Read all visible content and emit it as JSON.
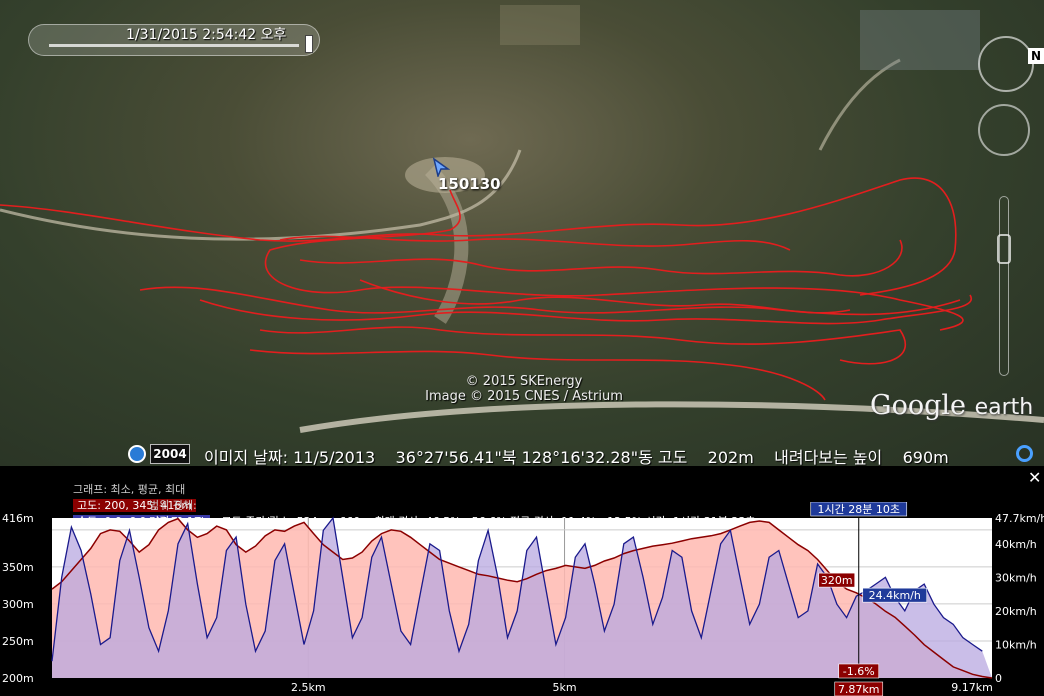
{
  "map": {
    "time_slider_label": "1/31/2015   2:54:42 오후",
    "placemark_label": "150130",
    "copyright_line1": "© 2015 SKEnergy",
    "copyright_line2": "Image © 2015 CNES / Astrium",
    "logo_google": "Google",
    "logo_earth": "earth",
    "north_label": "N"
  },
  "status": {
    "year": "2004",
    "info": "이미지 날짜: 11/5/2013    36°27'56.41\"북 128°16'32.28\"동 고도    202m    내려다보는 높이    690m"
  },
  "profile": {
    "graph_label": "그래프: 최소, 평균, 최대",
    "elevation_badge": "고도: 200, 345, 416m",
    "speed_badge": "속도: 0.0, 6.0, 47.7km/h",
    "range_label": "범위 전체:",
    "range_info": "거리: 9.17km 고도 증가/감소: 524m, -660m 최대 경사: 46.5%, -56.6% 평균 경사: 11.4%, -12.5% 시간: 1시간 31분 23초",
    "cursor_time": "1시간 28분 10초",
    "cursor_elev": "320m",
    "cursor_speed": "24.4km/h",
    "cursor_slope": "-1.6%",
    "cursor_dist": "7.87km",
    "x_ticks": [
      "2.5km",
      "5km",
      "9.17km"
    ],
    "y_left_ticks": [
      "416m",
      "350m",
      "300m",
      "250m",
      "200m"
    ],
    "y_right_ticks": [
      "47.7km/h",
      "40km/h",
      "30km/h",
      "20km/h",
      "10km/h",
      "0"
    ]
  },
  "chart_data": {
    "type": "area",
    "xlabel": "",
    "ylabel": "",
    "x_range_km": [
      0,
      9.17
    ],
    "elevation_range_m": [
      200,
      416
    ],
    "speed_range_kmh": [
      0,
      47.7
    ],
    "elevation_samples_m": [
      320,
      330,
      345,
      360,
      375,
      395,
      400,
      398,
      385,
      370,
      380,
      400,
      410,
      415,
      400,
      390,
      395,
      405,
      400,
      380,
      370,
      378,
      392,
      400,
      398,
      405,
      410,
      395,
      380,
      370,
      360,
      362,
      370,
      385,
      395,
      400,
      398,
      390,
      380,
      370,
      360,
      355,
      350,
      345,
      340,
      338,
      335,
      332,
      330,
      334,
      340,
      345,
      348,
      352,
      350,
      348,
      352,
      358,
      362,
      368,
      372,
      375,
      378,
      380,
      382,
      385,
      388,
      390,
      392,
      395,
      400,
      405,
      410,
      412,
      410,
      400,
      390,
      380,
      372,
      360,
      345,
      330,
      320,
      315,
      308,
      300,
      290,
      282,
      270,
      258,
      245,
      235,
      225,
      215,
      210,
      205,
      202,
      200
    ],
    "speed_samples_kmh": [
      5,
      30,
      45,
      38,
      25,
      10,
      12,
      35,
      44,
      30,
      15,
      8,
      20,
      40,
      46,
      28,
      12,
      18,
      38,
      42,
      22,
      8,
      14,
      35,
      40,
      25,
      10,
      20,
      44,
      47.7,
      30,
      12,
      18,
      36,
      42,
      28,
      14,
      10,
      25,
      40,
      38,
      20,
      8,
      16,
      35,
      44,
      30,
      12,
      20,
      38,
      42,
      26,
      10,
      18,
      36,
      40,
      28,
      14,
      22,
      40,
      42,
      30,
      16,
      24,
      38,
      36,
      20,
      12,
      26,
      40,
      44,
      30,
      16,
      22,
      36,
      38,
      28,
      18,
      20,
      34,
      30,
      22,
      18,
      24.4,
      26,
      28,
      30,
      24,
      20,
      26,
      28,
      22,
      18,
      16,
      12,
      10,
      8
    ]
  },
  "colors": {
    "track_red": "#e31e1e",
    "elevation_line": "#8b0000",
    "speed_line": "#1a1a8c",
    "elevation_fill": "#ffb8b0",
    "speed_fill": "#b8a8e0"
  }
}
